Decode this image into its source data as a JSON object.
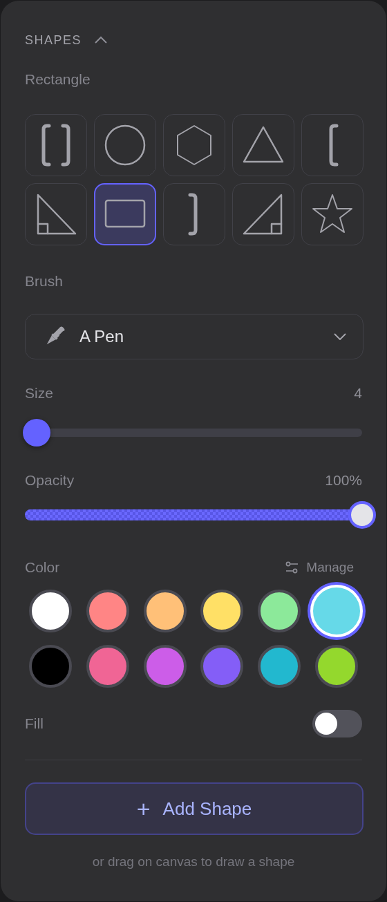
{
  "section": {
    "title": "SHAPES",
    "expanded": true
  },
  "shape_label": "Rectangle",
  "shapes": [
    {
      "kind": "brackets",
      "selected": false
    },
    {
      "kind": "circle",
      "selected": false
    },
    {
      "kind": "hexagon",
      "selected": false
    },
    {
      "kind": "triangle",
      "selected": false
    },
    {
      "kind": "left-bracket",
      "selected": false
    },
    {
      "kind": "right-triangle-left",
      "selected": false
    },
    {
      "kind": "rectangle",
      "selected": true
    },
    {
      "kind": "right-bracket",
      "selected": false
    },
    {
      "kind": "right-triangle-right",
      "selected": false
    },
    {
      "kind": "star",
      "selected": false
    }
  ],
  "brush": {
    "label": "Brush",
    "value": "A Pen"
  },
  "size": {
    "label": "Size",
    "reading": "4",
    "level": 0
  },
  "opacity": {
    "label": "Opacity",
    "reading": "100%",
    "level": 1
  },
  "color": {
    "label": "Color",
    "manage": "Manage"
  },
  "swatches": [
    {
      "color": "#ffffff",
      "selected": false
    },
    {
      "color": "#ff8585",
      "selected": false
    },
    {
      "color": "#ffc078",
      "selected": false
    },
    {
      "color": "#ffe066",
      "selected": false
    },
    {
      "color": "#8ce99a",
      "selected": false
    },
    {
      "color": "#66d9e8",
      "selected": true
    },
    {
      "color": "#000000",
      "selected": false
    },
    {
      "color": "#f06595",
      "selected": false
    },
    {
      "color": "#cc5de8",
      "selected": false
    },
    {
      "color": "#845ef7",
      "selected": false
    },
    {
      "color": "#22b8cf",
      "selected": false
    },
    {
      "color": "#94d82d",
      "selected": false
    }
  ],
  "fill": {
    "label": "Fill",
    "on": false
  },
  "add_button": {
    "icon": "+",
    "label": "Add Shape"
  },
  "hint": "or drag on canvas to draw a shape"
}
